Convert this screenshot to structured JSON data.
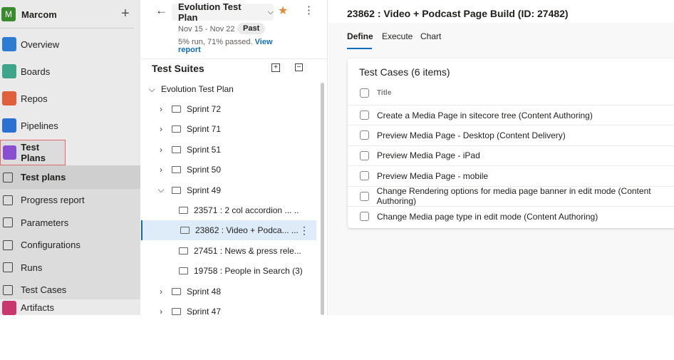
{
  "org": {
    "initial": "M",
    "name": "Marcom",
    "add_icon": "plus-icon"
  },
  "nav": [
    {
      "label": "Overview",
      "color": "#2b7cd3"
    },
    {
      "label": "Boards",
      "color": "#3da58a"
    },
    {
      "label": "Repos",
      "color": "#e0603b"
    },
    {
      "label": "Pipelines",
      "color": "#2b70d3"
    },
    {
      "label": "Test Plans",
      "color": "#8a4fd1"
    }
  ],
  "subnav": [
    "Test plans",
    "Progress report",
    "Parameters",
    "Configurations",
    "Runs",
    "Test Cases"
  ],
  "nav_bottom": {
    "label": "Artifacts",
    "color": "#c8386e"
  },
  "plan": {
    "title": "Evolution Test Plan",
    "dates": "Nov 15 - Nov 22",
    "badge": "Past",
    "stats": "5% run, 71% passed.",
    "view_report": "View report",
    "star_color": "#e08a3b"
  },
  "suites": {
    "title": "Test Suites",
    "root": "Evolution Test Plan",
    "items": [
      {
        "label": "Sprint 72",
        "level": 1,
        "expanded": false
      },
      {
        "label": "Sprint 71",
        "level": 1,
        "expanded": false
      },
      {
        "label": "Sprint 51",
        "level": 1,
        "expanded": false
      },
      {
        "label": "Sprint 50",
        "level": 1,
        "expanded": false
      },
      {
        "label": "Sprint 49",
        "level": 1,
        "expanded": true
      },
      {
        "label": "23571 : 2 col accordion ...  ..",
        "level": 2
      },
      {
        "label": "23862 : Video + Podca...  ...",
        "level": 2,
        "selected": true
      },
      {
        "label": "27451 : News & press rele...",
        "level": 2
      },
      {
        "label": "19758 : People in Search (3)",
        "level": 2
      },
      {
        "label": "Sprint 48",
        "level": 1,
        "expanded": false
      },
      {
        "label": "Sprint 47",
        "level": 1,
        "expanded": false
      }
    ]
  },
  "detail": {
    "title": "23862 : Video + Podcast Page Build (ID: 27482)",
    "tabs": [
      "Define",
      "Execute",
      "Chart"
    ],
    "active_tab": "Define",
    "card_title": "Test Cases (6 items)",
    "column": "Title",
    "cases": [
      "Create a Media Page in sitecore tree (Content Authoring)",
      "Preview Media Page - Desktop (Content Delivery)",
      "Preview Media Page - iPad",
      "Preview Media Page - mobile",
      "Change Rendering options for media page banner in edit mode (Content Authoring)",
      "Change Media page type in edit mode (Content Authoring)"
    ]
  }
}
